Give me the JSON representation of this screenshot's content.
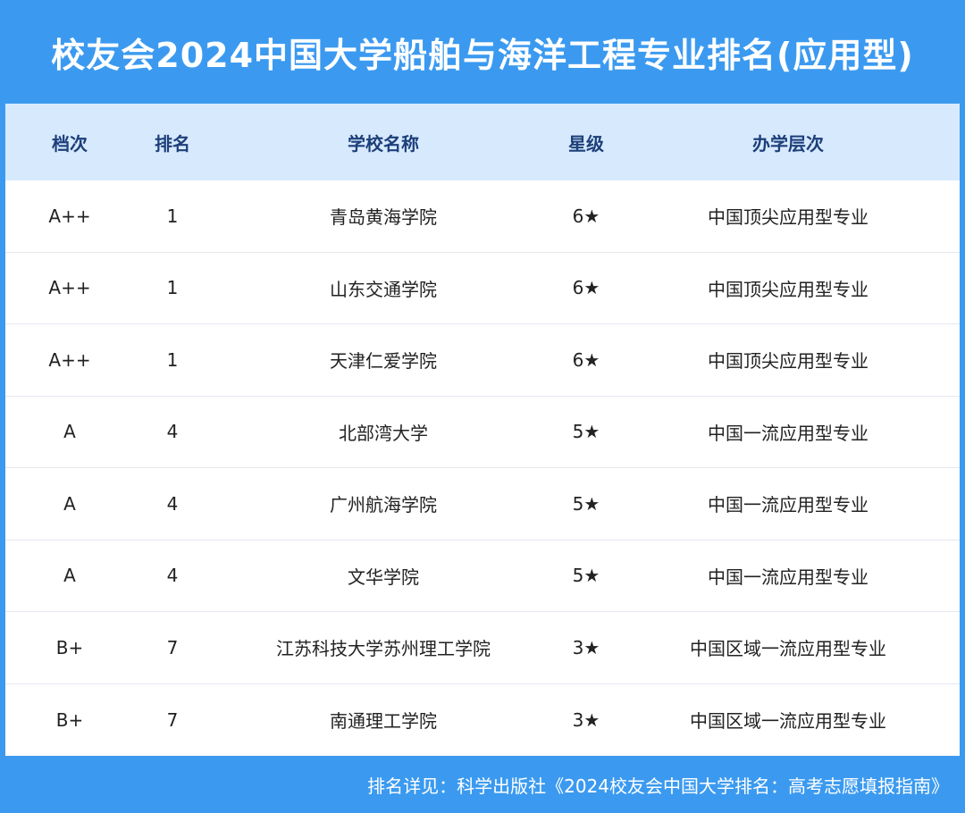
{
  "title": "校友会2024中国大学船舶与海洋工程专业排名(应用型)",
  "headers": [
    "档次",
    "排名",
    "学校名称",
    "星级",
    "办学层次"
  ],
  "rows": [
    [
      "A++",
      "1",
      "青岛黄海学院",
      "6★",
      "中国顶尖应用型专业"
    ],
    [
      "A++",
      "1",
      "山东交通学院",
      "6★",
      "中国顶尖应用型专业"
    ],
    [
      "A++",
      "1",
      "天津仁爱学院",
      "6★",
      "中国顶尖应用型专业"
    ],
    [
      "A",
      "4",
      "北部湾大学",
      "5★",
      "中国一流应用型专业"
    ],
    [
      "A",
      "4",
      "广州航海学院",
      "5★",
      "中国一流应用型专业"
    ],
    [
      "A",
      "4",
      "文华学院",
      "5★",
      "中国一流应用型专业"
    ],
    [
      "B+",
      "7",
      "江苏科技大学苏州理工学院",
      "3★",
      "中国区域一流应用型专业"
    ],
    [
      "B+",
      "7",
      "南通理工学院",
      "3★",
      "中国区域一流应用型专业"
    ]
  ],
  "footer": "排名详见：科学出版社《2024校友会中国大学排名：高考志愿填报指南》",
  "colors": {
    "background": "#3b9af0",
    "header_bg": "#d7eafd",
    "header_text": "#1d3f7a"
  }
}
